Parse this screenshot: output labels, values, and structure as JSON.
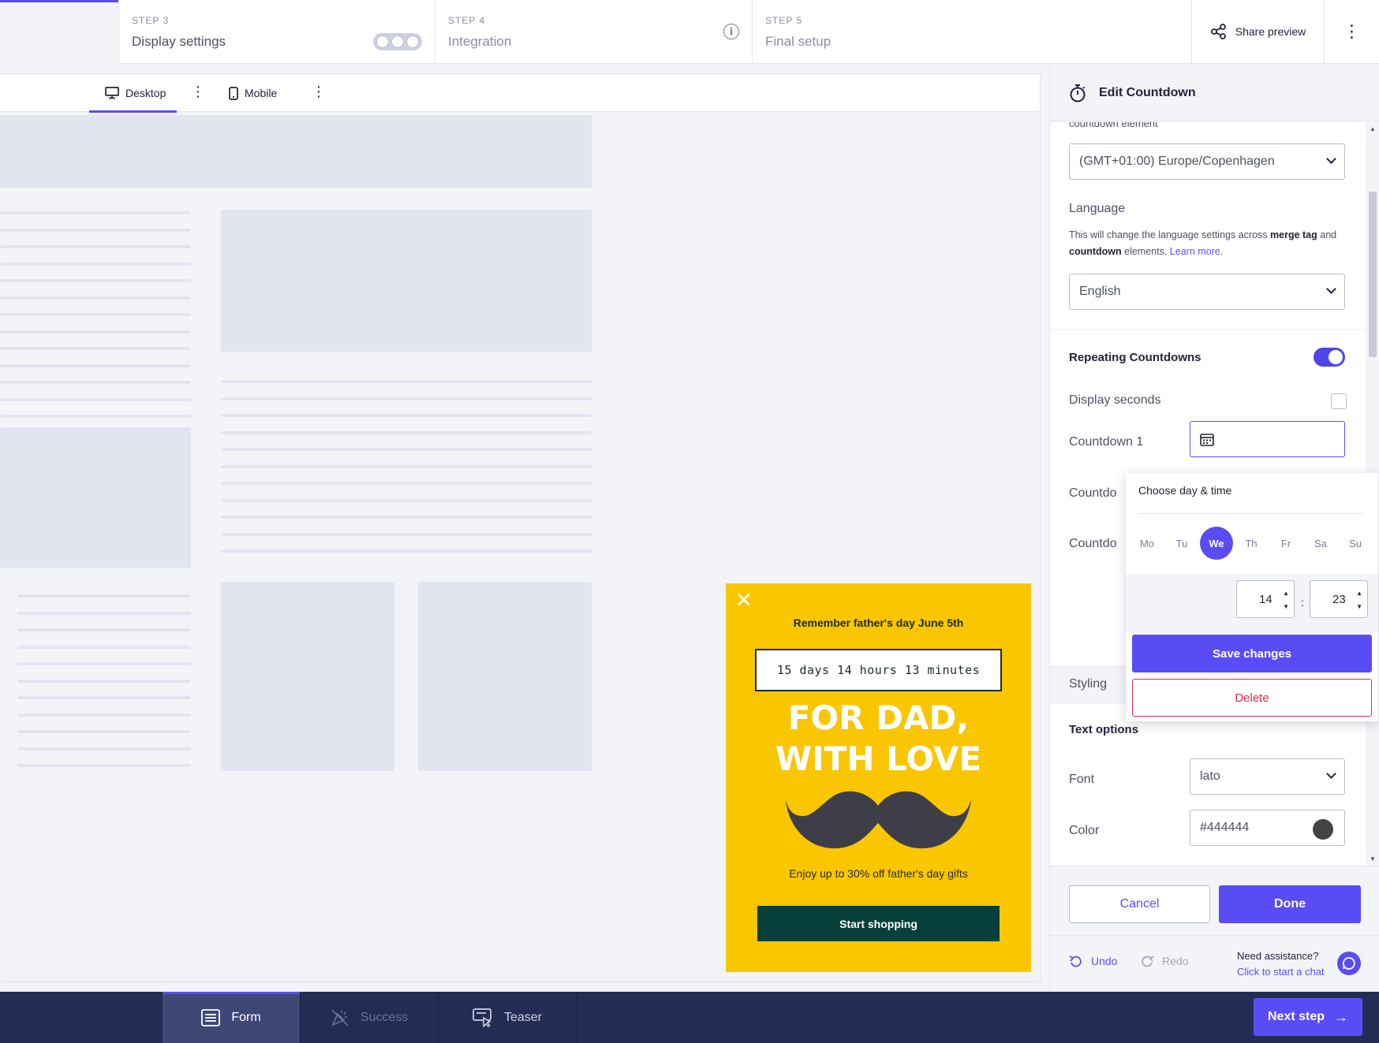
{
  "steps": [
    {
      "num": "STEP 3",
      "title": "Display settings"
    },
    {
      "num": "STEP 4",
      "title": "Integration"
    },
    {
      "num": "STEP 5",
      "title": "Final setup"
    }
  ],
  "header": {
    "share_label": "Share preview"
  },
  "device_tabs": {
    "desktop": "Desktop",
    "mobile": "Mobile"
  },
  "popup": {
    "headline": "Remember father's day June 5th",
    "countdown": "15 days 14 hours 13 minutes",
    "big_line1": "FOR DAD,",
    "big_line2": "WITH LOVE",
    "subtext": "Enjoy up to 30% off father's day gifts",
    "cta": "Start shopping",
    "bg_color": "#f9c600",
    "cta_color": "#073f3b"
  },
  "panel": {
    "title": "Edit Countdown",
    "cut_label": "countdown element",
    "timezone": "(GMT+01:00) Europe/Copenhagen",
    "language_label": "Language",
    "language_help_a": "This will change the language settings across ",
    "language_help_b": "merge tag",
    "language_help_c": " and ",
    "language_help_d": "countdown",
    "language_help_e": " elements. ",
    "language_help_link": "Learn more.",
    "language_value": "English",
    "repeating_label": "Repeating Countdowns",
    "repeating_on": true,
    "display_seconds_label": "Display seconds",
    "countdown1_label": "Countdown 1",
    "countdown2_label": "Countdo",
    "countdown3_label": "Countdo",
    "styling_label": "Styling",
    "text_options_label": "Text options",
    "font_label": "Font",
    "font_value": "lato",
    "color_label": "Color",
    "color_value": "#444444",
    "cancel": "Cancel",
    "done": "Done",
    "undo": "Undo",
    "redo": "Redo",
    "assist_q": "Need assistance?",
    "assist_link": "Click to start a chat"
  },
  "picker": {
    "title": "Choose day & time",
    "days": [
      "Mo",
      "Tu",
      "We",
      "Th",
      "Fr",
      "Sa",
      "Su"
    ],
    "selected_day": "We",
    "hour": "14",
    "minute": "23",
    "colon": ":",
    "save": "Save changes",
    "delete": "Delete"
  },
  "bottom_tabs": {
    "form": "Form",
    "success": "Success",
    "teaser": "Teaser"
  },
  "next_step": "Next step",
  "colors": {
    "accent": "#5a4cf5",
    "navy": "#252c54",
    "danger": "#dc2d4b"
  }
}
